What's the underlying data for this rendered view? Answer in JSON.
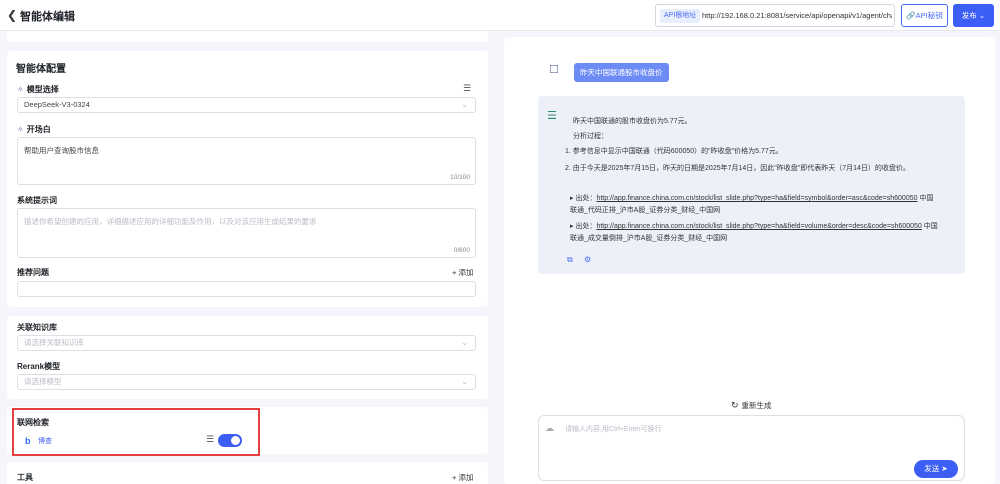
{
  "header": {
    "title": "智能体编辑",
    "api_tag": "API根地址",
    "api_url": "http://192.168.0.21:8081/service/api/openapi/v1/agent/chat",
    "api_key_label": "API秘钥",
    "publish_label": "发布"
  },
  "config": {
    "section_title": "智能体配置",
    "model_label": "模型选择",
    "model_value": "DeepSeek-V3-0324",
    "opening_label": "开场白",
    "opening_value": "帮助用户查询股市信息",
    "opening_counter": "10/100",
    "prompt_label": "系统提示词",
    "prompt_placeholder": "描述你希望创建的应用，详细描述应用的详细功能及作用，以及对该应用生成结果的要求",
    "prompt_counter": "0/600",
    "suggest_label": "推荐问题",
    "add_label": "+ 添加"
  },
  "knowledge": {
    "kb_label": "关联知识库",
    "kb_placeholder": "请选择关联知识库",
    "rerank_label": "Rerank模型",
    "rerank_placeholder": "请选择模型"
  },
  "web_search": {
    "label": "联网检索",
    "provider": "博查",
    "enabled": true
  },
  "tools": {
    "label": "工具",
    "add_label": "+ 添加"
  },
  "chat": {
    "user_message": "昨天中国联通股市收盘价",
    "answer_line1": "昨天中国联通的股市收盘价为5.77元。",
    "answer_line2": "分析过程：",
    "answer_line3": "1. 参考信息中显示中国联通（代码600050）的\"昨收盘\"价格为5.77元。",
    "answer_line4": "2. 由于今天是2025年7月15日，昨天的日期是2025年7月14日，因此\"昨收盘\"即代表昨天（7月14日）的收盘价。",
    "source1_prefix": "▸ 出处：",
    "source1_url": "http://app.finance.china.com.cn/stock/list_slide.php?type=ha&field=symbol&order=asc&code=sh600050",
    "source1_suffix": "中国",
    "source1_line2": "联通_代码正排_沪市A股_证券分类_财经_中国网",
    "source2_prefix": "▸ 出处：",
    "source2_url": "http://app.finance.china.com.cn/stock/list_slide.php?type=ha&field=volume&order=desc&code=sh600050",
    "source2_suffix": "中国",
    "source2_line2": "联通_成交量倒排_沪市A股_证券分类_财经_中国网",
    "regenerate_label": "重新生成",
    "input_placeholder": "请输入内容,用Ctrl+Enter可换行",
    "send_label": "发送"
  }
}
